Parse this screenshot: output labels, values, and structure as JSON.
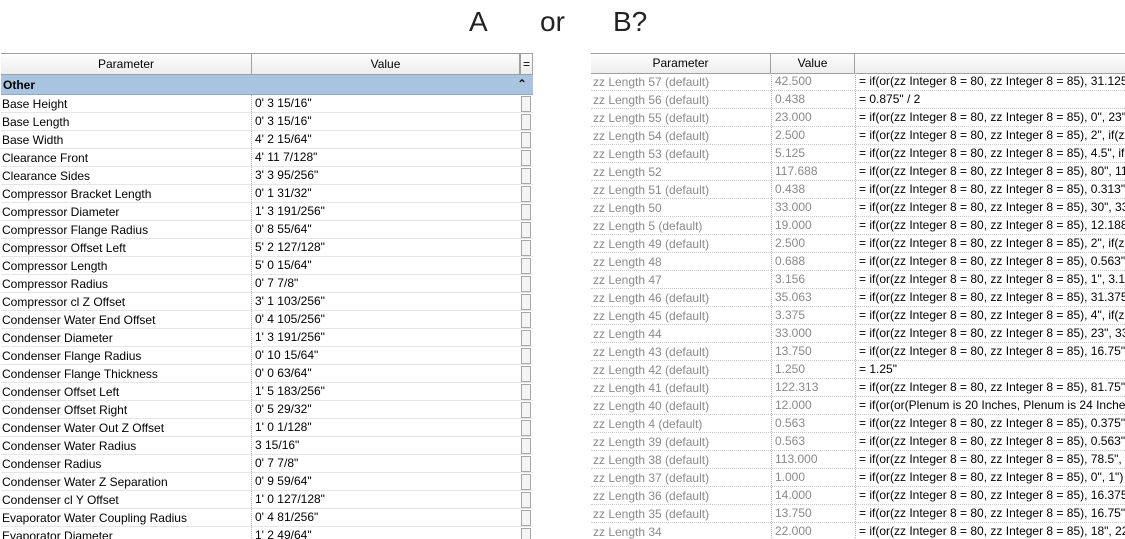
{
  "headline": {
    "a": "A",
    "or": "or",
    "b": "B?"
  },
  "panel_a": {
    "columns": {
      "parameter": "Parameter",
      "value": "Value",
      "button": "="
    },
    "group": {
      "label": "Other",
      "toggle": "⌃"
    },
    "rows": [
      {
        "name": "Base Height",
        "value": "0'  3 15/16\""
      },
      {
        "name": "Base Length",
        "value": "0'  3 15/16\""
      },
      {
        "name": "Base Width",
        "value": "4'  2 15/64\""
      },
      {
        "name": "Clearance Front",
        "value": "4'  11 7/128\""
      },
      {
        "name": "Clearance Sides",
        "value": "3'  3 95/256\""
      },
      {
        "name": "Compressor Bracket Length",
        "value": "0'  1 31/32\""
      },
      {
        "name": "Compressor Diameter",
        "value": "1'  3 191/256\""
      },
      {
        "name": "Compressor Flange Radius",
        "value": "0'  8 55/64\""
      },
      {
        "name": "Compressor Offset Left",
        "value": "5'  2 127/128\""
      },
      {
        "name": "Compressor Length",
        "value": "5'  0 15/64\""
      },
      {
        "name": "Compressor Radius",
        "value": "0'  7 7/8\""
      },
      {
        "name": "Compressor cl Z Offset",
        "value": "3'  1 103/256\""
      },
      {
        "name": "Condenser Water End Offset",
        "value": "0'  4 105/256\""
      },
      {
        "name": "Condenser Diameter",
        "value": "1'  3 191/256\""
      },
      {
        "name": "Condenser Flange Radius",
        "value": "0'  10 15/64\""
      },
      {
        "name": "Condenser Flange Thickness",
        "value": "0'  0 63/64\""
      },
      {
        "name": "Condenser Offset Left",
        "value": "1'  5 183/256\""
      },
      {
        "name": "Condenser Offset Right",
        "value": "0'  5 29/32\""
      },
      {
        "name": "Condenser Water Out Z Offset",
        "value": "1'  0 1/128\""
      },
      {
        "name": "Condenser Water Radius",
        "value": "3 15/16\""
      },
      {
        "name": "Condenser Radius",
        "value": "0'  7 7/8\""
      },
      {
        "name": "Condenser Water Z Separation",
        "value": "0'  9 59/64\""
      },
      {
        "name": "Condenser cl Y Offset",
        "value": "1'  0 127/128\""
      },
      {
        "name": "Evaporator Water Coupling Radius",
        "value": "0'  4 81/256\""
      },
      {
        "name": "Evaporator Diameter",
        "value": "1'  2 49/64\""
      }
    ]
  },
  "panel_b": {
    "columns": {
      "parameter": "Parameter",
      "value": "Value",
      "formula": ""
    },
    "rows": [
      {
        "name": "zz Length 57 (default)",
        "value": "42.500",
        "formula": "= if(or(zz Integer 8 = 80, zz Integer 8 = 85), 31.125\","
      },
      {
        "name": "zz Length 56 (default)",
        "value": "0.438",
        "formula": "= 0.875\" / 2"
      },
      {
        "name": "zz Length 55 (default)",
        "value": "23.000",
        "formula": "= if(or(zz Integer 8 = 80, zz Integer 8 = 85), 0\", 23\")"
      },
      {
        "name": "zz Length 54 (default)",
        "value": "2.500",
        "formula": "= if(or(zz Integer 8 = 80, zz Integer 8 = 85), 2\", if(zz I"
      },
      {
        "name": "zz Length 53 (default)",
        "value": "5.125",
        "formula": "= if(or(zz Integer 8 = 80, zz Integer 8 = 85), 4.5\", if(zz"
      },
      {
        "name": "zz Length 52",
        "value": "117.688",
        "formula": "= if(or(zz Integer 8 = 80, zz Integer 8 = 85), 80\", 117."
      },
      {
        "name": "zz Length 51 (default)",
        "value": "0.438",
        "formula": "= if(or(zz Integer 8 = 80, zz Integer 8 = 85), 0.313\", if"
      },
      {
        "name": "zz Length 50",
        "value": "33.000",
        "formula": "= if(or(zz Integer 8 = 80, zz Integer 8 = 85), 30\", 33\")"
      },
      {
        "name": "zz Length 5 (default)",
        "value": "19.000",
        "formula": "= if(or(zz Integer 8 = 80, zz Integer 8 = 85), 12.188\","
      },
      {
        "name": "zz Length 49 (default)",
        "value": "2.500",
        "formula": "= if(or(zz Integer 8 = 80, zz Integer 8 = 85), 2\", if(zz I"
      },
      {
        "name": "zz Length 48",
        "value": "0.688",
        "formula": "= if(or(zz Integer 8 = 80, zz Integer 8 = 85), 0.563\", 0"
      },
      {
        "name": "zz Length 47",
        "value": "3.156",
        "formula": "= if(or(zz Integer 8 = 80, zz Integer 8 = 85), 1\", 3.156"
      },
      {
        "name": "zz Length 46 (default)",
        "value": "35.063",
        "formula": "= if(or(zz Integer 8 = 80, zz Integer 8 = 85), 31.375\","
      },
      {
        "name": "zz Length 45 (default)",
        "value": "3.375",
        "formula": "= if(or(zz Integer 8 = 80, zz Integer 8 = 85), 4\", if(zz I"
      },
      {
        "name": "zz Length 44",
        "value": "33.000",
        "formula": "= if(or(zz Integer 8 = 80, zz Integer 8 = 85), 23\", 33\")"
      },
      {
        "name": "zz Length 43 (default)",
        "value": "13.750",
        "formula": "= if(or(zz Integer 8 = 80, zz Integer 8 = 85), 16.75\", if"
      },
      {
        "name": "zz Length 42 (default)",
        "value": "1.250",
        "formula": "= 1.25\""
      },
      {
        "name": "zz Length 41 (default)",
        "value": "122.313",
        "formula": "= if(or(zz Integer 8 = 80, zz Integer 8 = 85), 81.75\", if"
      },
      {
        "name": "zz Length 40 (default)",
        "value": "12.000",
        "formula": "= if(or(or(Plenum is 20 Inches, Plenum is 24 Inches,"
      },
      {
        "name": "zz Length 4 (default)",
        "value": "0.563",
        "formula": "= if(or(zz Integer 8 = 80, zz Integer 8 = 85), 0.375\", if"
      },
      {
        "name": "zz Length 39 (default)",
        "value": "0.563",
        "formula": "= if(or(zz Integer 8 = 80, zz Integer 8 = 85), 0.563\", if"
      },
      {
        "name": "zz Length 38 (default)",
        "value": "113.000",
        "formula": "= if(or(zz Integer 8 = 80, zz Integer 8 = 85), 78.5\", if("
      },
      {
        "name": "zz Length 37 (default)",
        "value": "1.000",
        "formula": "= if(or(zz Integer 8 = 80, zz Integer 8 = 85), 0\", 1\")"
      },
      {
        "name": "zz Length 36 (default)",
        "value": "14.000",
        "formula": "= if(or(zz Integer 8 = 80, zz Integer 8 = 85), 16.375\","
      },
      {
        "name": "zz Length 35 (default)",
        "value": "13.750",
        "formula": "= if(or(zz Integer 8 = 80, zz Integer 8 = 85), 16.75\", if"
      },
      {
        "name": "zz Length 34",
        "value": "22.000",
        "formula": "= if(or(zz Integer 8 = 80, zz Integer 8 = 85), 18\", 22\")"
      }
    ]
  }
}
